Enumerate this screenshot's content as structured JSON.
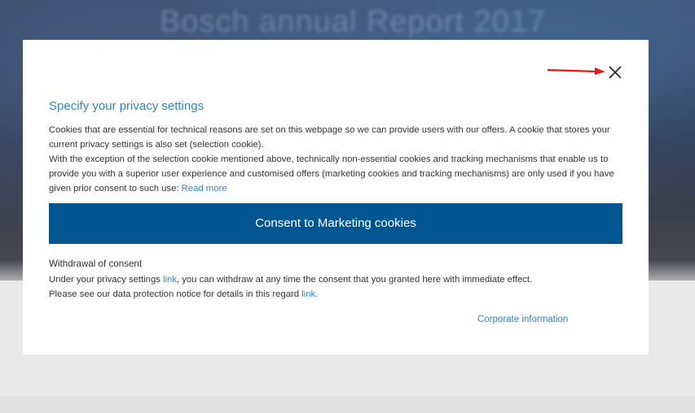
{
  "background": {
    "hero_title": "Bosch annual Report 2017"
  },
  "modal": {
    "title": "Specify your privacy settings",
    "intro_line1": "Cookies that are essential for technical reasons are set on this webpage so we can provide users with our offers. A cookie that stores your current privacy settings is also set (selection cookie).",
    "intro_line2": "With the exception of the selection cookie mentioned above, technically non-essential cookies and tracking mechanisms that enable us to provide you with a superior user experience and customised offers (marketing cookies and tracking mechanisms) are only used if you have given prior consent to such use: ",
    "read_more": "Read more",
    "consent_button": "Consent to Marketing cookies",
    "withdrawal_title": "Withdrawal of consent",
    "withdrawal_pre": "Under your privacy settings ",
    "withdrawal_link1": "link",
    "withdrawal_post": ", you can withdraw at any time the consent that you granted here with immediate effect.",
    "notice_pre": "Please see our data protection notice for details in this regard ",
    "notice_link": "link",
    "notice_post": ".",
    "corporate_info": "Corporate information"
  },
  "colors": {
    "accent_blue": "#2f87b5",
    "button_blue": "#005691",
    "arrow_red": "#e01b1b"
  },
  "icons": {
    "close": "close-icon",
    "annotation": "red-arrow-icon"
  }
}
